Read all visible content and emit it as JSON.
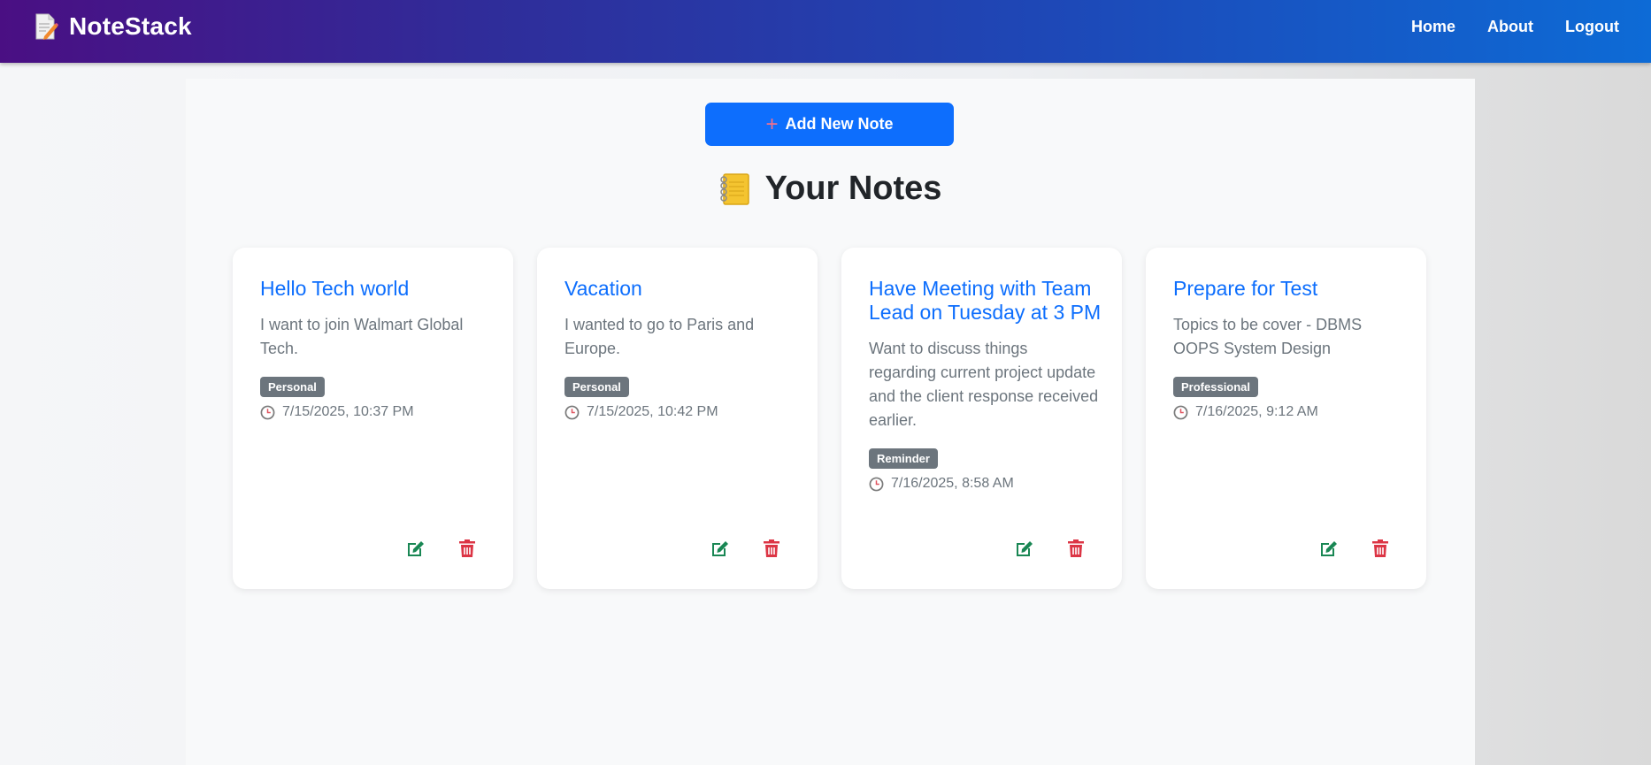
{
  "brand": {
    "name": "NoteStack",
    "icon": "notepad-pencil-icon"
  },
  "nav": {
    "home": "Home",
    "about": "About",
    "logout": "Logout"
  },
  "add_button": {
    "label": "Add New Note",
    "icon": "plus-icon"
  },
  "section": {
    "title": "Your Notes",
    "icon": "notebook-icon"
  },
  "notes": [
    {
      "title": "Hello Tech world",
      "body": "I want to join Walmart Global Tech.",
      "tag": "Personal",
      "timestamp": "7/15/2025, 10:37 PM"
    },
    {
      "title": "Vacation",
      "body": "I wanted to go to Paris and Europe.",
      "tag": "Personal",
      "timestamp": "7/15/2025, 10:42 PM"
    },
    {
      "title": "Have Meeting with Team Lead on Tuesday at 3 PM",
      "body": "Want to discuss things regarding current project update and the client response received earlier.",
      "tag": "Reminder",
      "timestamp": "7/16/2025, 8:58 AM"
    },
    {
      "title": "Prepare for Test",
      "body": "Topics to be cover - DBMS OOPS System Design",
      "tag": "Professional",
      "timestamp": "7/16/2025, 9:12 AM"
    }
  ],
  "colors": {
    "primary": "#0d6efd",
    "edit": "#198754",
    "delete": "#dc3545",
    "badge": "#6c757d"
  }
}
